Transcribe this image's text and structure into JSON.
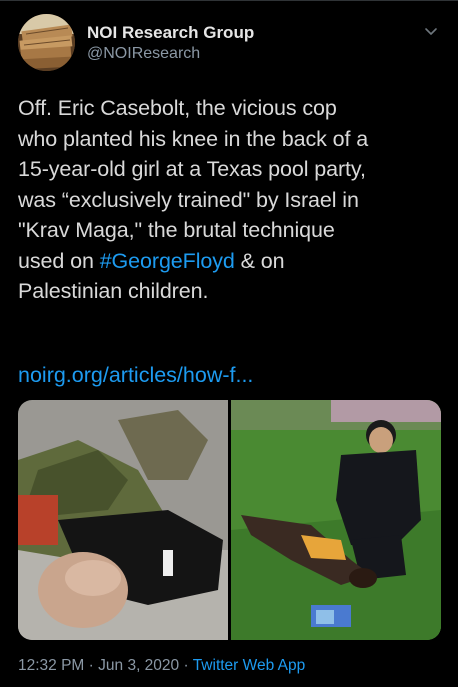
{
  "tweet": {
    "author": {
      "display_name": "NOI Research Group",
      "handle": "@NOIResearch",
      "avatar_icon": "book-stack-avatar"
    },
    "menu_icon": "chevron-down-icon",
    "text_lines": {
      "l1": "Off. Eric Casebolt, the vicious cop",
      "l2": "who planted his knee in the back of a",
      "l3": "15-year-old girl at a Texas pool party,",
      "l4": "was “exclusively trained\" by Israel in",
      "l5": "\"Krav Maga,\" the brutal technique",
      "l6_before": "used on ",
      "l6_hashtag": "#GeorgeFloyd",
      "l6_after": " & on",
      "l7": "Palestinian children."
    },
    "link": "noirg.org/articles/how-f...",
    "media": {
      "left": "photo-soldier-kneeling-on-man",
      "right": "photo-officer-kneeling-on-girl"
    },
    "time": "12:32 PM",
    "separator": "·",
    "date": "Jun 3, 2020",
    "source": "Twitter Web App",
    "colors": {
      "background": "#000000",
      "text": "#d9d9d9",
      "secondary": "#8b98a5",
      "link": "#1d9bf0"
    }
  }
}
